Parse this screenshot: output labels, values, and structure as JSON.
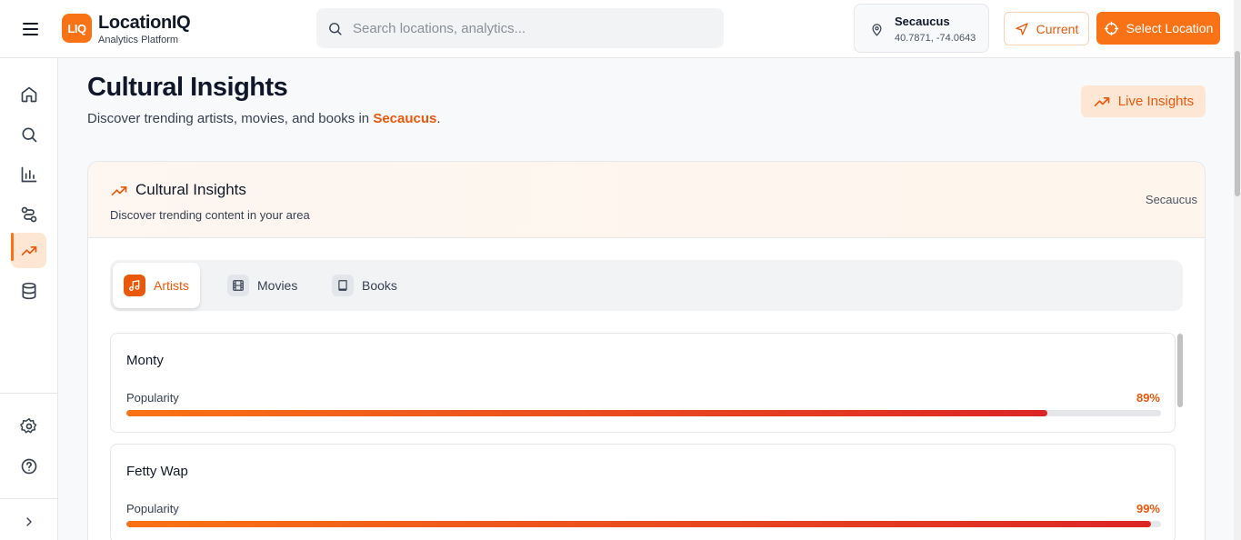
{
  "header": {
    "logo_mark": "LIQ",
    "app_name": "LocationIQ",
    "app_subtitle": "Analytics Platform",
    "search_placeholder": "Search locations, analytics...",
    "location_name": "Secaucus",
    "location_coords": "40.7871, -74.0643",
    "current_label": "Current",
    "select_location_label": "Select Location"
  },
  "sidebar": {
    "items": [
      {
        "icon": "home-icon"
      },
      {
        "icon": "search-icon"
      },
      {
        "icon": "bar-chart-icon"
      },
      {
        "icon": "route-icon"
      },
      {
        "icon": "trending-up-icon",
        "active": true
      },
      {
        "icon": "database-icon"
      }
    ],
    "bottom_items": [
      {
        "icon": "settings-icon"
      },
      {
        "icon": "help-icon"
      }
    ],
    "expand_icon": "chevron-right-icon"
  },
  "page": {
    "title": "Cultural Insights",
    "description_prefix": "Discover trending artists, movies, and books in ",
    "description_location": "Secaucus",
    "description_suffix": ".",
    "live_badge": "Live Insights"
  },
  "card": {
    "title": "Cultural Insights",
    "subtitle": "Discover trending content in your area",
    "location": "Secaucus",
    "tabs": [
      {
        "label": "Artists",
        "icon": "music-icon",
        "active": true
      },
      {
        "label": "Movies",
        "icon": "film-icon",
        "active": false
      },
      {
        "label": "Books",
        "icon": "book-icon",
        "active": false
      }
    ],
    "popularity_label": "Popularity",
    "items": [
      {
        "name": "Monty",
        "popularity": "89%",
        "popularity_value": 89
      },
      {
        "name": "Fetty Wap",
        "popularity": "99%",
        "popularity_value": 99
      }
    ]
  },
  "colors": {
    "accent": "#f97316",
    "accent_dark": "#ea580c",
    "bar_end": "#dc2626"
  }
}
